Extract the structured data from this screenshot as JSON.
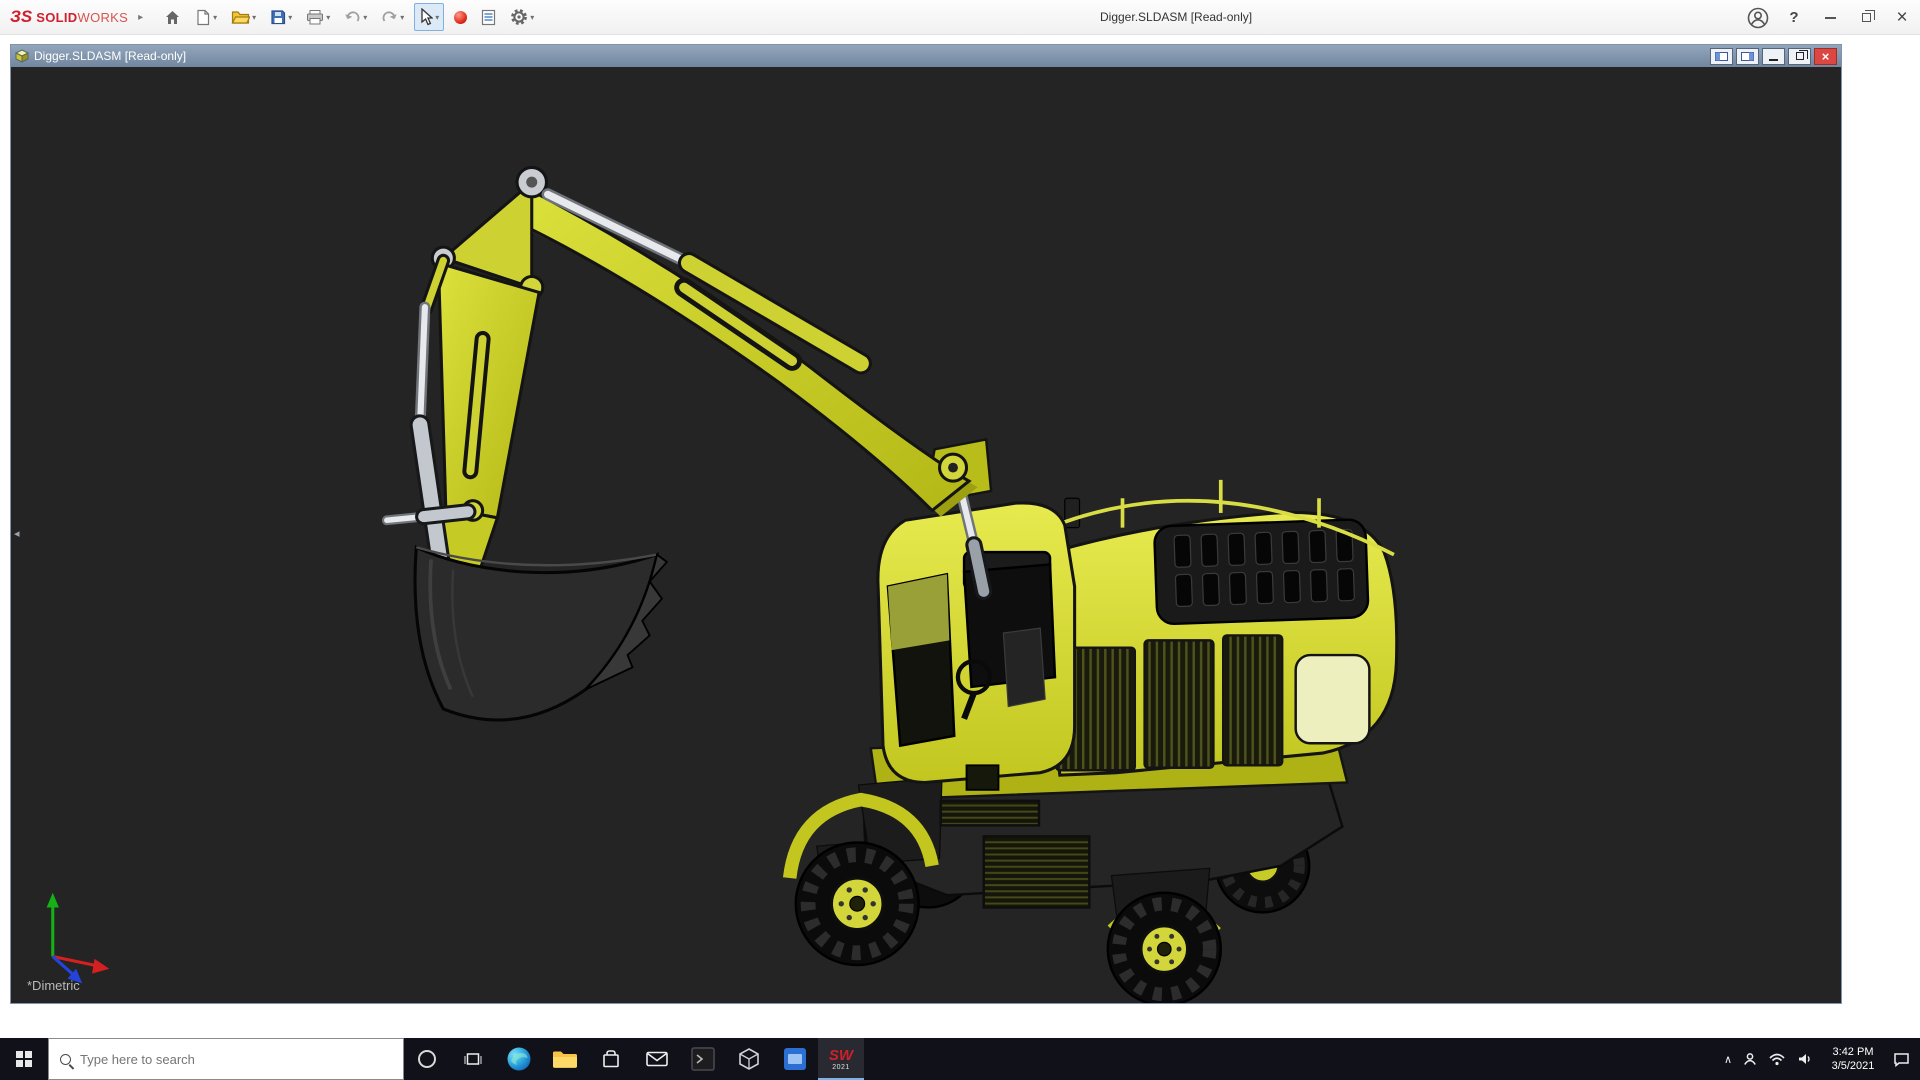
{
  "app": {
    "logo_mark": "ЗS",
    "brand_bold": "SOLID",
    "brand_light": "WORKS",
    "window_title": "Digger.SLDASM [Read-only]"
  },
  "doc": {
    "title": "Digger.SLDASM [Read-only]"
  },
  "viewport": {
    "view_label": "*Dimetric"
  },
  "taskbar": {
    "search_placeholder": "Type here to search",
    "clock_time": "3:42 PM",
    "clock_date": "3/5/2021",
    "solidworks_label": "SW",
    "solidworks_year": "2021"
  },
  "glyphs": {
    "expand_arrow": "▸",
    "caret": "▾",
    "help": "?",
    "close": "×",
    "doc_close": "×",
    "tray_chevron": "∧",
    "collapse_arrow": "◂"
  },
  "colors": {
    "brand_red": "#cf2030",
    "excavator_yellow": "#d6da33",
    "doc_titlebar": "#8095ae",
    "viewport_bg": "#242424",
    "taskbar_bg": "#11111a",
    "close_red": "#dd4742"
  }
}
